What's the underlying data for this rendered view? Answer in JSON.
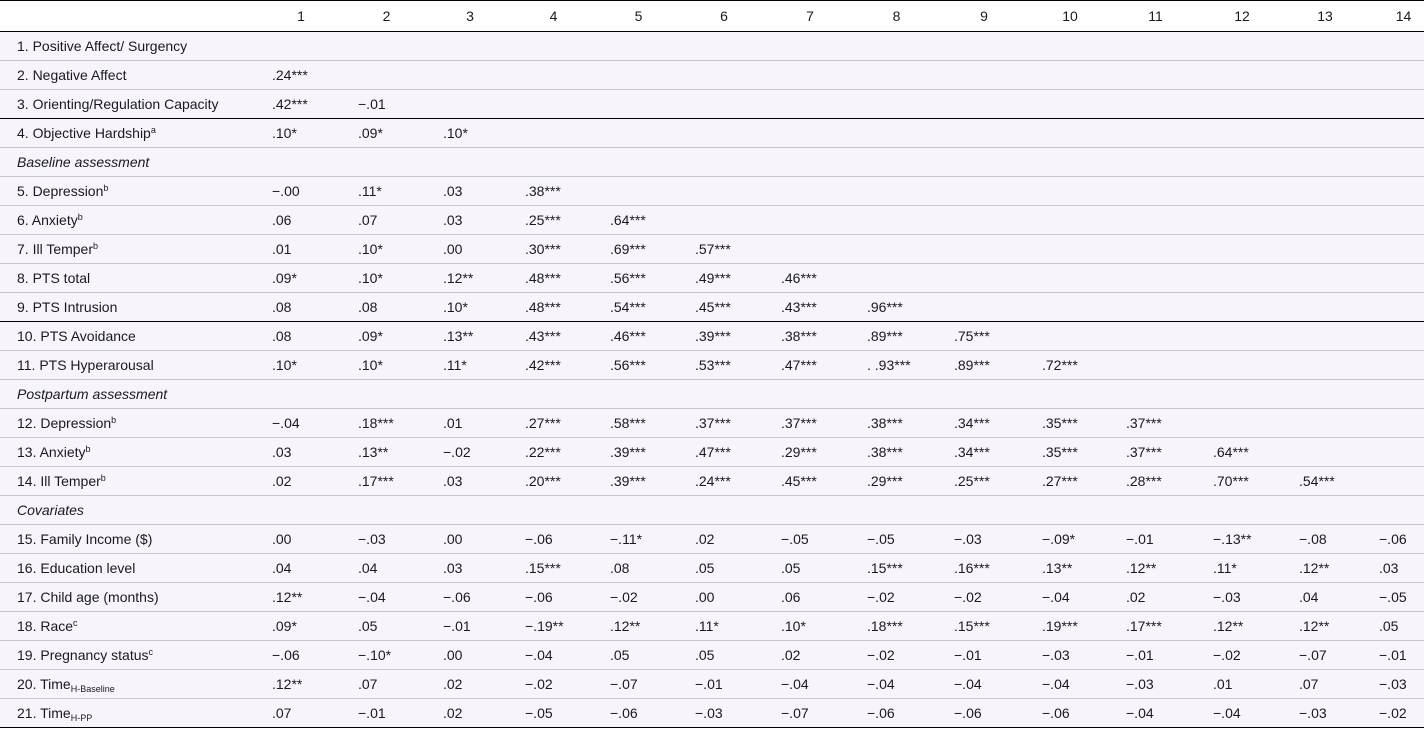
{
  "header": [
    "1",
    "2",
    "3",
    "4",
    "5",
    "6",
    "7",
    "8",
    "9",
    "10",
    "11",
    "12",
    "13",
    "14"
  ],
  "rows": [
    {
      "label": "1. Positive Affect/ Surgency",
      "values": []
    },
    {
      "label": "2. Negative Affect",
      "values": [
        ".24***"
      ]
    },
    {
      "label": "3. Orienting/Regulation Capacity",
      "values": [
        ".42***",
        "−.01"
      ]
    },
    {
      "label": "4. Objective Hardship",
      "sup": "a",
      "values": [
        ".10*",
        ".09*",
        ".10*"
      ]
    },
    {
      "section": "Baseline assessment"
    },
    {
      "label": "5. Depression",
      "sup": "b",
      "values": [
        "−.00",
        ".11*",
        ".03",
        ".38***"
      ]
    },
    {
      "label": "6. Anxiety",
      "sup": "b",
      "values": [
        ".06",
        ".07",
        ".03",
        ".25***",
        ".64***"
      ]
    },
    {
      "label": "7. Ill Temper",
      "sup": "b",
      "values": [
        ".01",
        ".10*",
        ".00",
        ".30***",
        ".69***",
        ".57***"
      ]
    },
    {
      "label": "8. PTS total",
      "values": [
        ".09*",
        ".10*",
        ".12**",
        ".48***",
        ".56***",
        ".49***",
        ".46***"
      ]
    },
    {
      "label": "9. PTS Intrusion",
      "values": [
        ".08",
        ".08",
        ".10*",
        ".48***",
        ".54***",
        ".45***",
        ".43***",
        ".96***"
      ]
    },
    {
      "label": "10. PTS Avoidance",
      "values": [
        ".08",
        ".09*",
        ".13**",
        ".43***",
        ".46***",
        ".39***",
        ".38***",
        ".89***",
        ".75***"
      ]
    },
    {
      "label": "11. PTS Hyperarousal",
      "values": [
        ".10*",
        ".10*",
        ".11*",
        ".42***",
        ".56***",
        ".53***",
        ".47***",
        ". .93***",
        ".89***",
        ".72***"
      ]
    },
    {
      "section": "Postpartum assessment"
    },
    {
      "label": "12. Depression",
      "sup": "b",
      "values": [
        "−.04",
        ".18***",
        ".01",
        ".27***",
        ".58***",
        ".37***",
        ".37***",
        ".38***",
        ".34***",
        ".35***",
        ".37***"
      ]
    },
    {
      "label": "13. Anxiety",
      "sup": "b",
      "values": [
        ".03",
        ".13**",
        "−.02",
        ".22***",
        ".39***",
        ".47***",
        ".29***",
        ".38***",
        ".34***",
        ".35***",
        ".37***",
        ".64***"
      ]
    },
    {
      "label": "14. Ill Temper",
      "sup": "b",
      "values": [
        ".02",
        ".17***",
        ".03",
        ".20***",
        ".39***",
        ".24***",
        ".45***",
        ".29***",
        ".25***",
        ".27***",
        ".28***",
        ".70***",
        ".54***"
      ]
    },
    {
      "section": "Covariates"
    },
    {
      "label": "15. Family Income ($)",
      "values": [
        ".00",
        "−.03",
        ".00",
        "−.06",
        "−.11*",
        ".02",
        "−.05",
        "−.05",
        "−.03",
        "−.09*",
        "−.01",
        "−.13**",
        "−.08",
        "−.06"
      ]
    },
    {
      "label": "16. Education level",
      "values": [
        ".04",
        ".04",
        ".03",
        ".15***",
        ".08",
        ".05",
        ".05",
        ".15***",
        ".16***",
        ".13**",
        ".12**",
        ".11*",
        ".12**",
        ".03"
      ]
    },
    {
      "label": "17. Child age (months)",
      "values": [
        ".12**",
        "−.04",
        "−.06",
        "−.06",
        "−.02",
        ".00",
        ".06",
        "−.02",
        "−.02",
        "−.04",
        ".02",
        "−.03",
        ".04",
        "−.05"
      ]
    },
    {
      "label": "18. Race",
      "sup": "c",
      "values": [
        ".09*",
        ".05",
        "−.01",
        "−.19**",
        ".12**",
        ".11*",
        ".10*",
        ".18***",
        ".15***",
        ".19***",
        ".17***",
        ".12**",
        ".12**",
        ".05"
      ]
    },
    {
      "label": "19. Pregnancy status",
      "sup": "c",
      "values": [
        "−.06",
        "−.10*",
        ".00",
        "−.04",
        ".05",
        ".05",
        ".02",
        "−.02",
        "−.01",
        "−.03",
        "−.01",
        "−.02",
        "−.07",
        "−.01"
      ]
    },
    {
      "label": "20. Time",
      "sub": "H-Baseline",
      "values": [
        ".12**",
        ".07",
        ".02",
        "−.02",
        "−.07",
        "−.01",
        "−.04",
        "−.04",
        "−.04",
        "−.04",
        "−.03",
        ".01",
        ".07",
        "−.03"
      ]
    },
    {
      "label": "21. Time",
      "sub": "H-PP",
      "values": [
        ".07",
        "−.01",
        ".02",
        "−.05",
        "−.06",
        "−.03",
        "−.07",
        "−.06",
        "−.06",
        "−.06",
        "−.04",
        "−.04",
        "−.03",
        "−.02"
      ]
    }
  ]
}
